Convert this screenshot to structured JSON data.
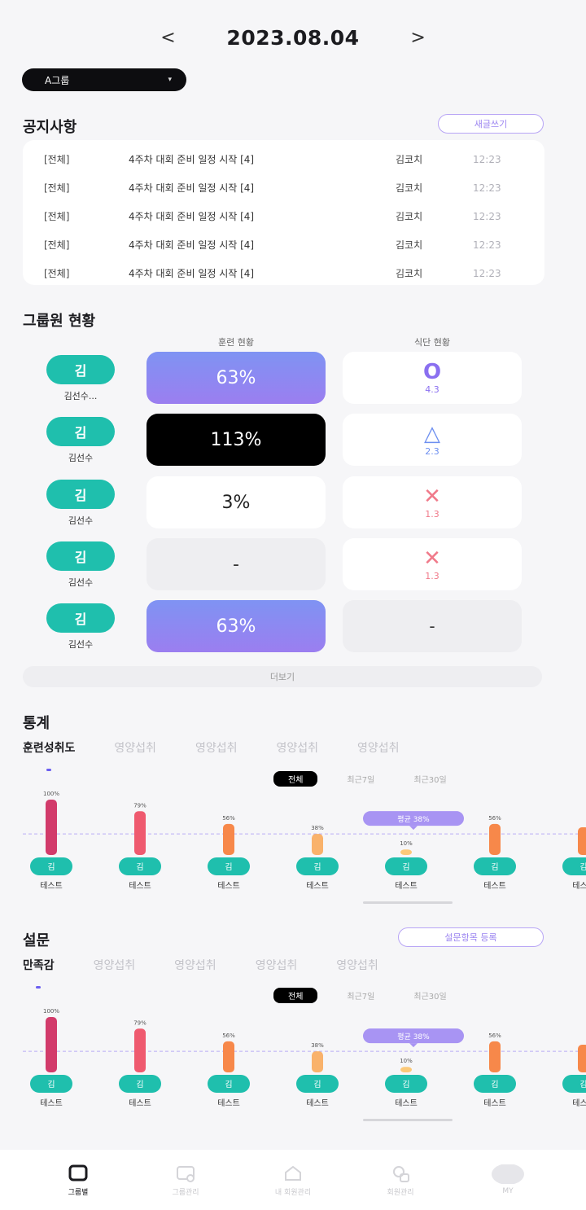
{
  "header": {
    "prev": "<",
    "date": "2023.08.04",
    "next": ">"
  },
  "group_select": {
    "value": "A그룹",
    "chevron": "▾"
  },
  "notice": {
    "title": "공지사항",
    "more_label": "새글쓰기",
    "rows": [
      {
        "cat": "[전체]",
        "title": "4주차 대회 준비 일정 시작 [4]",
        "author": "김코치",
        "time": "12:23"
      },
      {
        "cat": "[전체]",
        "title": "4주차 대회 준비 일정 시작 [4]",
        "author": "김코치",
        "time": "12:23"
      },
      {
        "cat": "[전체]",
        "title": "4주차 대회 준비 일정 시작 [4]",
        "author": "김코치",
        "time": "12:23"
      },
      {
        "cat": "[전체]",
        "title": "4주차 대회 준비 일정 시작 [4]",
        "author": "김코치",
        "time": "12:23"
      },
      {
        "cat": "[전체]",
        "title": "4주차 대회 준비 일정 시작 [4]",
        "author": "김코치",
        "time": "12:23"
      }
    ]
  },
  "group_status": {
    "title": "그룹원 현황",
    "col1": "훈련 현황",
    "col2": "식단 현황",
    "members": [
      {
        "avatar": "김",
        "name": "김선수...",
        "train": "63%",
        "train_style": "grad",
        "diet_symbol": "O",
        "diet_score": "4.3",
        "diet_color": "#8a6ff0",
        "diet_style": "white"
      },
      {
        "avatar": "김",
        "name": "김선수",
        "train": "113%",
        "train_style": "dark",
        "diet_symbol": "△",
        "diet_score": "2.3",
        "diet_color": "#6d8ff0",
        "diet_style": "white"
      },
      {
        "avatar": "김",
        "name": "김선수",
        "train": "3%",
        "train_style": "white",
        "diet_symbol": "✕",
        "diet_score": "1.3",
        "diet_color": "#f07a8a",
        "diet_style": "white"
      },
      {
        "avatar": "김",
        "name": "김선수",
        "train": "-",
        "train_style": "empty",
        "diet_symbol": "✕",
        "diet_score": "1.3",
        "diet_color": "#f07a8a",
        "diet_style": "white"
      },
      {
        "avatar": "김",
        "name": "김선수",
        "train": "63%",
        "train_style": "grad",
        "diet_symbol": "",
        "diet_score": "-",
        "diet_color": "#333333",
        "diet_style": "empty"
      }
    ],
    "more_label": "더보기"
  },
  "stats": {
    "title": "통계",
    "tabs": [
      "훈련성취도",
      "영양섭취",
      "영양섭취",
      "영양섭취",
      "영양섭취"
    ],
    "segments": [
      "전체",
      "최근7일",
      "최근30일"
    ],
    "avg_label": "평균 38%"
  },
  "survey": {
    "title": "설문",
    "add_label": "설문항목 등록",
    "tabs": [
      "만족감",
      "영양섭취",
      "영양섭취",
      "영양섭취",
      "영양섭취"
    ],
    "segments": [
      "전체",
      "최근7일",
      "최근30일"
    ],
    "avg_label": "평균 38%"
  },
  "chart_data": [
    {
      "type": "bar",
      "categories": [
        "테스트",
        "테스트",
        "테스트",
        "테스트",
        "테스트",
        "테스트",
        "테스트"
      ],
      "avatars": [
        "김",
        "김",
        "김",
        "김",
        "김",
        "김",
        "김"
      ],
      "values": [
        100,
        79,
        56,
        38,
        10,
        56,
        50
      ],
      "value_labels": [
        "100%",
        "79%",
        "56%",
        "38%",
        "10%",
        "56%",
        ""
      ],
      "colors": [
        "#d23b6b",
        "#ef5a6f",
        "#f7884a",
        "#f9b26b",
        "#fbc979",
        "#f7884a",
        "#f7884a"
      ],
      "average": 38
    },
    {
      "type": "bar",
      "categories": [
        "테스트",
        "테스트",
        "테스트",
        "테스트",
        "테스트",
        "테스트",
        "테스트"
      ],
      "avatars": [
        "김",
        "김",
        "김",
        "김",
        "김",
        "김",
        "김"
      ],
      "values": [
        100,
        79,
        56,
        38,
        10,
        56,
        50
      ],
      "value_labels": [
        "100%",
        "79%",
        "56%",
        "38%",
        "10%",
        "56%",
        ""
      ],
      "colors": [
        "#d23b6b",
        "#ef5a6f",
        "#f7884a",
        "#f9b26b",
        "#fbc979",
        "#f7884a",
        "#f7884a"
      ],
      "average": 38
    }
  ],
  "bottom_nav": [
    {
      "label": "그룹별",
      "icon": "group-icon",
      "active": true
    },
    {
      "label": "그룹관리",
      "icon": "group-manage-icon",
      "active": false
    },
    {
      "label": "내 회원관리",
      "icon": "home-icon",
      "active": false
    },
    {
      "label": "회원관리",
      "icon": "member-icon",
      "active": false
    },
    {
      "label": "MY",
      "icon": "profile-icon",
      "active": false
    }
  ]
}
